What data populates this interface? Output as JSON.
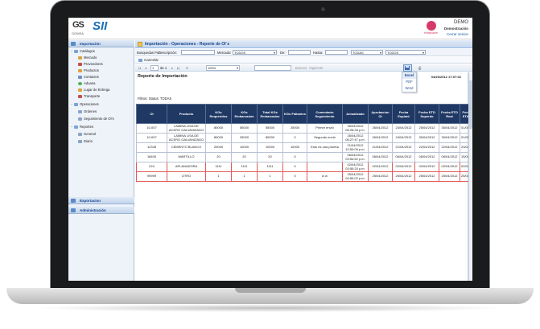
{
  "header": {
    "logo_gs": "GS",
    "logo_gs_sub": "GOMSA",
    "logo_si": "SII",
    "demo_logo_text": "entityname",
    "user_name": "DEMO",
    "company": "Demostración",
    "logout": "Cerrar sesion"
  },
  "sidebar": {
    "sections": [
      {
        "label": "Importación"
      },
      {
        "label": "Exportacion"
      },
      {
        "label": "Administración"
      }
    ],
    "items": [
      {
        "label": "Catálogos",
        "level": 0,
        "color": "#7aa3d4"
      },
      {
        "label": "Mercado",
        "level": 1,
        "color": "#d9a441"
      },
      {
        "label": "Proveedores",
        "level": 1,
        "color": "#c0504d"
      },
      {
        "label": "Productos",
        "level": 1,
        "color": "#d9a441"
      },
      {
        "label": "Contactos",
        "level": 1,
        "color": "#6b93c7"
      },
      {
        "label": "Aduana",
        "level": 1,
        "color": "#4caf50"
      },
      {
        "label": "Lugar de Entrega",
        "level": 1,
        "color": "#d9a441"
      },
      {
        "label": "Transporte",
        "level": 1,
        "color": "#c0504d"
      },
      {
        "label": "Operaciones",
        "level": 0,
        "color": "#7aa3d4"
      },
      {
        "label": "Ordenes",
        "level": 1,
        "color": "#8aa4c8"
      },
      {
        "label": "Seguimiento de OI's",
        "level": 1,
        "color": "#8aa4c8"
      },
      {
        "label": "Reportes",
        "level": 0,
        "color": "#7aa3d4"
      },
      {
        "label": "General",
        "level": 1,
        "color": "#8aa4c8"
      },
      {
        "label": "Diario",
        "level": 1,
        "color": "#8aa4c8"
      }
    ]
  },
  "main": {
    "panel_title": "Importación - Operaciones - Reporte de OI`s",
    "filters": {
      "busquedas_label": "Busquedas Por:",
      "descripcion_label": "Descripción:",
      "mercado_label": "Mercado:",
      "mercado_value": "TODOS",
      "de_label": "De:",
      "hasta_label": "Hasta:",
      "select1_value": "TODAS",
      "select2_value": "TODOS"
    },
    "cancel_label": "Cancelar",
    "viewer": {
      "first": "|◂",
      "prev": "◂",
      "page": "1",
      "of": "de 1",
      "next": "▸",
      "last": "▸|",
      "zoom": "100%",
      "find_placeholder": "",
      "find_label": "Buscar",
      "next_label": "Siguiente"
    },
    "export_menu": [
      "Excel",
      "PDF",
      "Word"
    ]
  },
  "report": {
    "title": "Reporte de Importación",
    "date": "04/26/2012 17:07:02",
    "filter_line": "Filtros: Status: TODAS",
    "columns": [
      "OI",
      "Producto",
      "KGs Requeridos",
      "KGs Embarcados",
      "Total KGs Embarcados",
      "KGs Faltantes",
      "Comentario Seguimiento",
      "Actualizado",
      "Aprobacion OI",
      "Fecha Esplant",
      "Fecha ETD Superdo",
      "Fecha ETD Real",
      "Fecl ETA"
    ],
    "rows": [
      [
        "10-007",
        "LAMINA LISA DE ACERO GALVANIZADO",
        "80000",
        "55000",
        "55000",
        "25000",
        "Primer envió",
        "26/04/2012 06:26:28 p.m.",
        "26/04/2012",
        "24/04/2012",
        "25/04/2012",
        "30/04/2012",
        "01/05/"
      ],
      [
        "10-007",
        "LAMINA LISA DE ACERO GALVANIZADO",
        "80000",
        "25000",
        "80000",
        "0",
        "Segundo envió",
        "26/04/2012 06:27:47 p.m.",
        "26/04/2012",
        "24/04/2012",
        "30/04/2012",
        "30/04/2012",
        "01/05/"
      ],
      [
        "12345",
        "CEMENTO BLANCO",
        "20000",
        "10000",
        "10000",
        "10000",
        "Esto es una prueba",
        "21/04/2012 10:53:09 p.m.",
        "21/04/2012",
        "21/04/2012",
        "22/04/2012",
        "22/04/2012",
        "23/04/"
      ],
      [
        "18400",
        "MARTILLO",
        "20",
        "20",
        "20",
        "0",
        "",
        "06/04/2012 03:54:52 p.m.",
        "06/04/2012",
        "06/04/2012",
        "06/04/2012",
        "06/04/2012",
        "15/04/"
      ],
      [
        "224",
        "APLANADORA",
        "1111",
        "1111",
        "1111",
        "0",
        "",
        "02/04/2012 03:50:20 p.m.",
        "02/04/2012",
        "02/04/2012",
        "02/04/2012",
        "02/04/2012",
        "02/04/"
      ],
      [
        "99999",
        "OTRO",
        "1",
        "1",
        "1",
        "0",
        "w w",
        "25/04/2012 04:50:02 p.m.",
        "25/04/2012",
        "25/04/2012",
        "25/04/2012",
        "25/04/2012",
        "25/04/"
      ]
    ]
  }
}
